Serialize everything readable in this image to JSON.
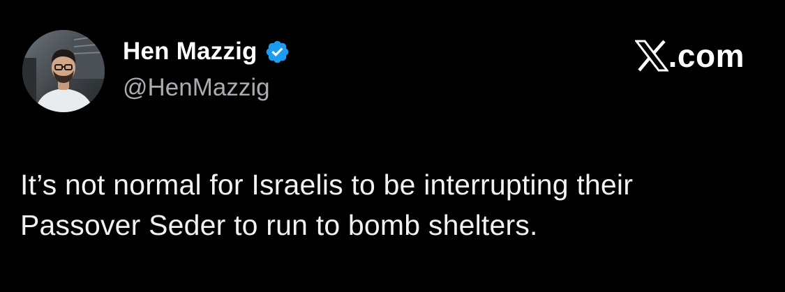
{
  "tweet": {
    "author": {
      "display_name": "Hen Mazzig",
      "handle": "@HenMazzig",
      "verified": true,
      "avatar": "profile-photo"
    },
    "brand": {
      "logo": "x-logo-icon",
      "domain": ".com"
    },
    "text_lines": [
      "It’s not normal for Israelis to be interrupting their",
      "Passover Seder to run to bomb shelters."
    ]
  },
  "colors": {
    "background": "#000000",
    "name": "#ffffff",
    "handle": "#a9adb1",
    "text": "#f2f2f2",
    "verified_badge": "#1d9bf0"
  }
}
